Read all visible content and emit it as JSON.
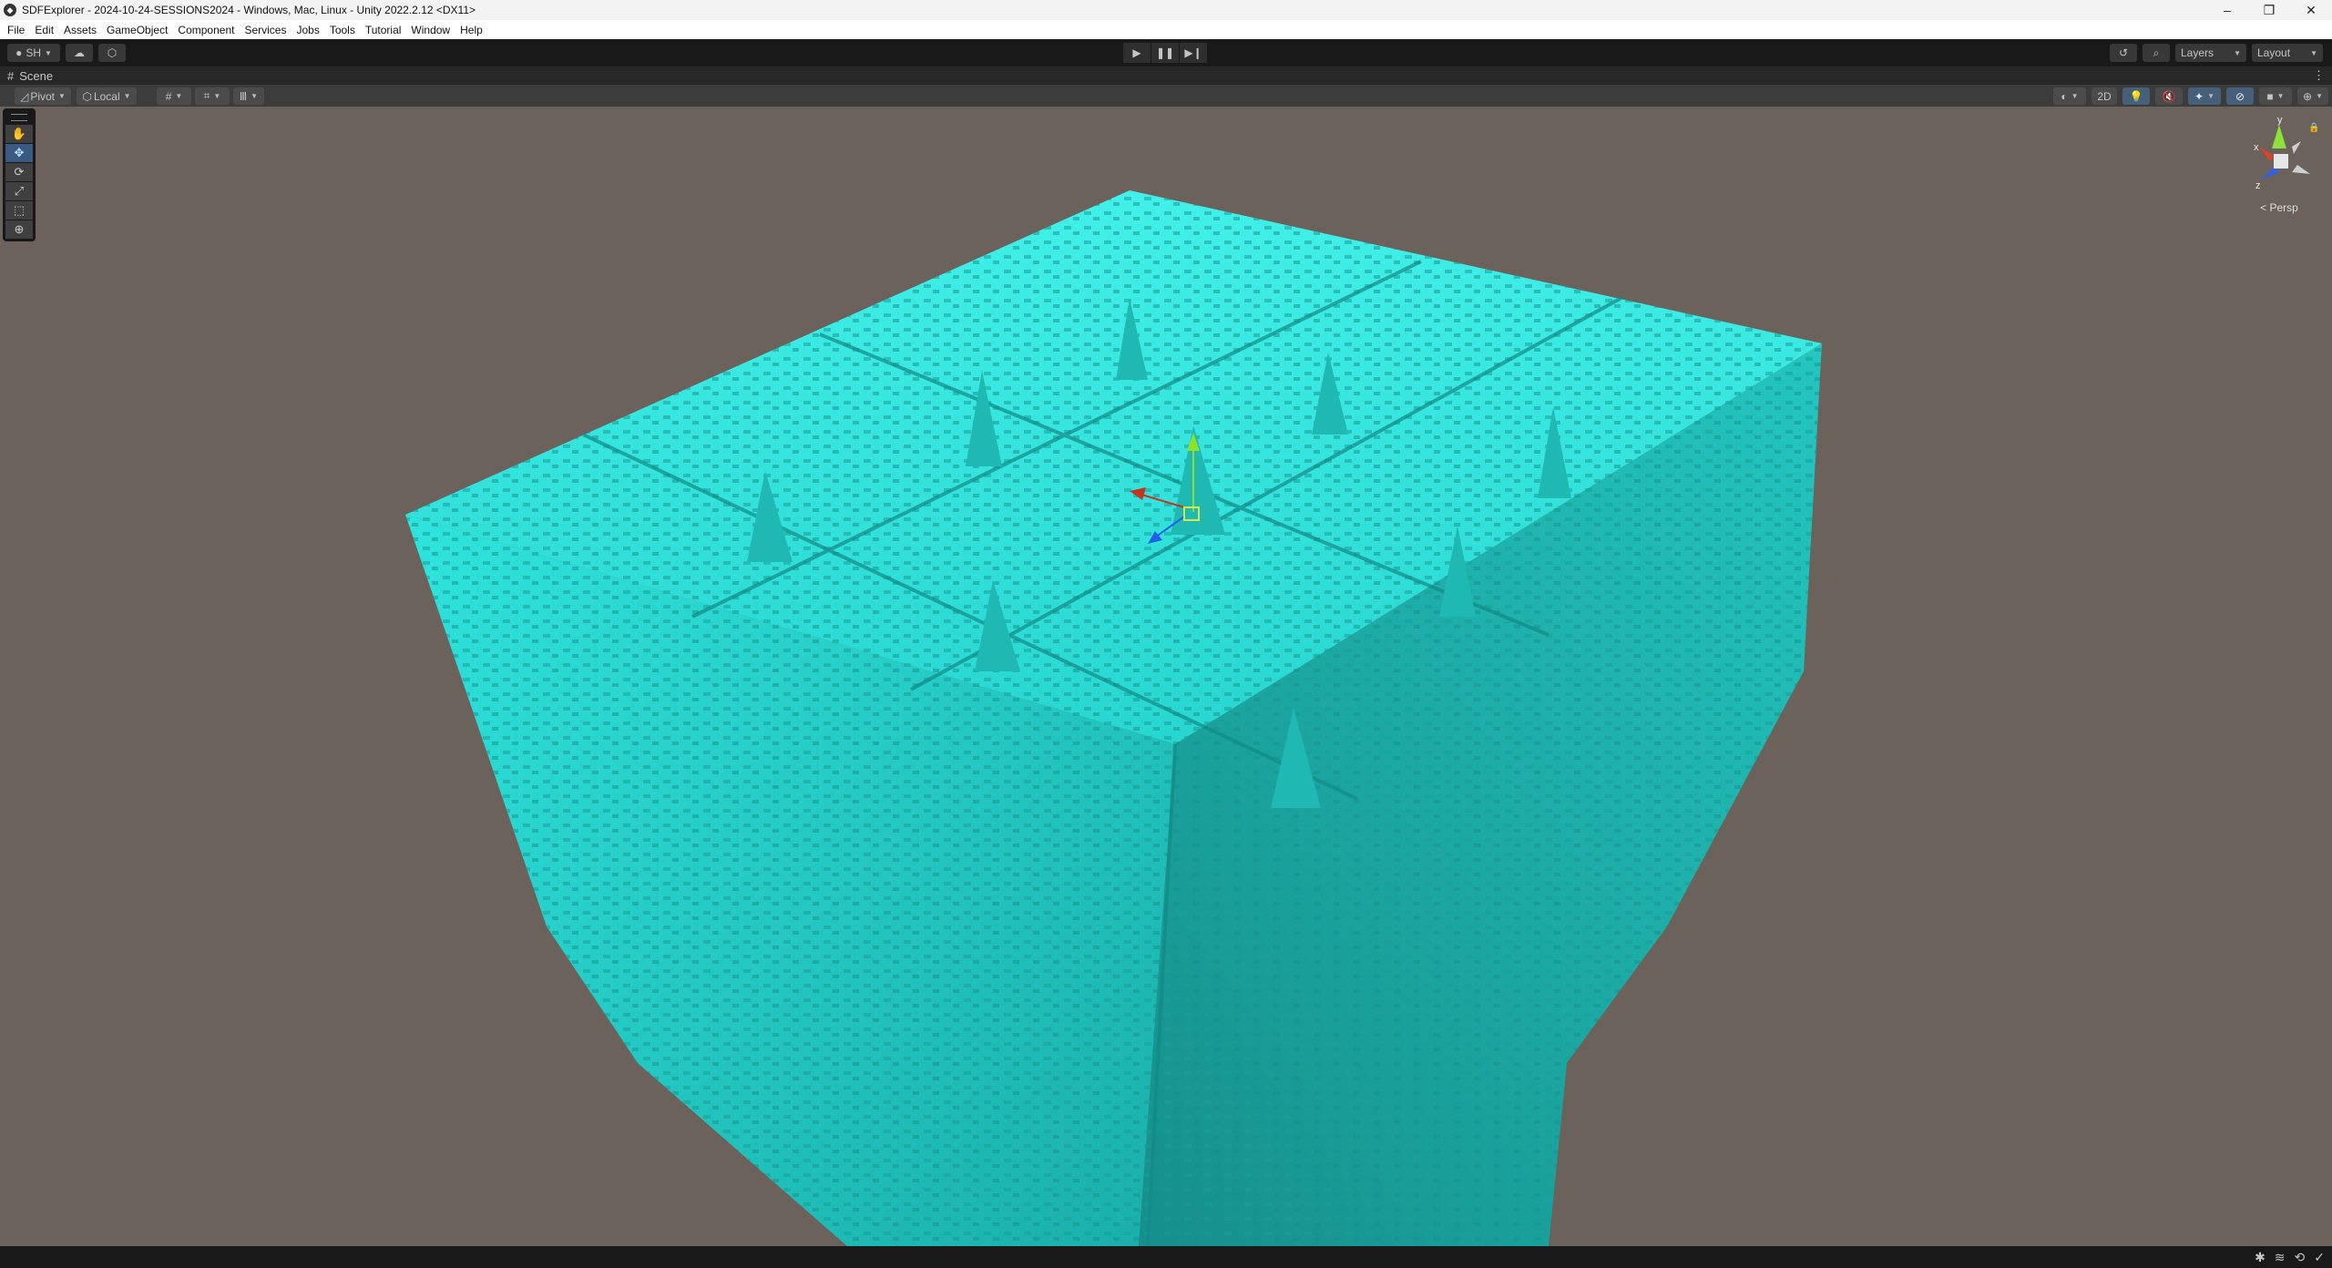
{
  "window": {
    "title": "SDFExplorer - 2024-10-24-SESSIONS2024 - Windows, Mac, Linux - Unity 2022.2.12 <DX11>",
    "controls": {
      "minimize": "–",
      "maximize": "❐",
      "close": "✕"
    }
  },
  "menu": [
    "File",
    "Edit",
    "Assets",
    "GameObject",
    "Component",
    "Services",
    "Jobs",
    "Tools",
    "Tutorial",
    "Window",
    "Help"
  ],
  "toolbar": {
    "account_label": "SH",
    "cloud_icon": "cloud-icon",
    "collab_icon": "package-icon",
    "play_icon": "play-icon",
    "pause_icon": "pause-icon",
    "step_icon": "step-icon",
    "history_icon": "history-icon",
    "search_icon": "search-icon",
    "layers_label": "Layers",
    "layout_label": "Layout"
  },
  "scene_tab": {
    "label": "Scene",
    "icon": "grid-hash-icon"
  },
  "scene_toolbar": {
    "pivot_label": "Pivot",
    "local_label": "Local",
    "mode_2d_label": "2D",
    "lighting_active": true,
    "hidden_objects_active": true,
    "effects_active": true
  },
  "tools": [
    {
      "name": "hand-tool",
      "glyph": "✋",
      "active": false
    },
    {
      "name": "move-tool",
      "glyph": "✥",
      "active": true
    },
    {
      "name": "rotate-tool",
      "glyph": "⟳",
      "active": false
    },
    {
      "name": "scale-tool",
      "glyph": "⤢",
      "active": false
    },
    {
      "name": "rect-tool",
      "glyph": "⬚",
      "active": false
    },
    {
      "name": "transform-tool",
      "glyph": "⊕",
      "active": false
    }
  ],
  "scene_gizmo": {
    "projection_label": "Persp",
    "axes": {
      "x": "x",
      "y": "y",
      "z": "z"
    }
  },
  "scene": {
    "object_color": "#2ee6e0",
    "background_color": "#6b625c"
  },
  "status_icons": [
    "debug-icon",
    "cache-icon",
    "sync-icon",
    "check-icon"
  ]
}
